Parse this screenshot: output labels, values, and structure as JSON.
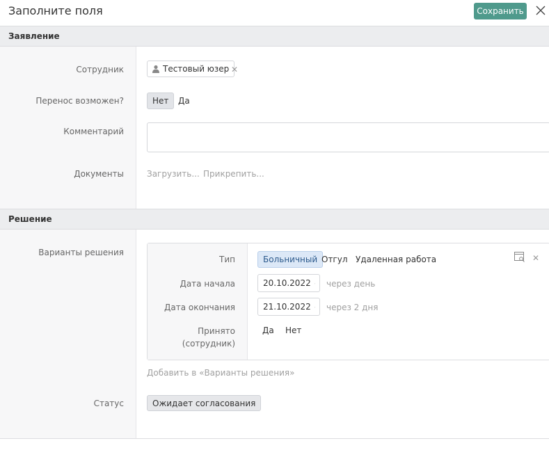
{
  "header": {
    "title": "Заполните поля",
    "save_label": "Сохранить"
  },
  "sections": {
    "statement": "Заявление",
    "decision": "Решение"
  },
  "statement": {
    "employee_label": "Сотрудник",
    "employee_value": "Тестовый юзер",
    "transfer_label": "Перенос возможен?",
    "transfer_options": [
      "Нет",
      "Да"
    ],
    "transfer_selected": "Нет",
    "comment_label": "Комментарий",
    "comment_value": "",
    "documents_label": "Документы",
    "upload_link": "Загрузить...",
    "attach_link": "Прикрепить..."
  },
  "decision": {
    "variants_label": "Варианты решения",
    "variant": {
      "type_label": "Тип",
      "type_options": [
        "Больничный",
        "Отгул",
        "Удаленная работа"
      ],
      "type_selected": "Больничный",
      "start_label": "Дата начала",
      "start_value": "20.10.2022",
      "start_hint": "через день",
      "end_label": "Дата окончания",
      "end_value": "21.10.2022",
      "end_hint": "через 2 дня",
      "accepted_label_line1": "Принято",
      "accepted_label_line2": "(сотрудник)",
      "accepted_options": [
        "Да",
        "Нет"
      ]
    },
    "add_variant_link": "Добавить в «Варианты решения»",
    "status_label": "Статус",
    "status_value": "Ожидает согласования"
  },
  "colors": {
    "accent": "#4f9a8c",
    "section_bg": "#ecedef",
    "active_type_bg": "#dce8f7"
  },
  "icons": [
    "close-icon",
    "user-icon",
    "calendar-icon",
    "preview-icon"
  ]
}
